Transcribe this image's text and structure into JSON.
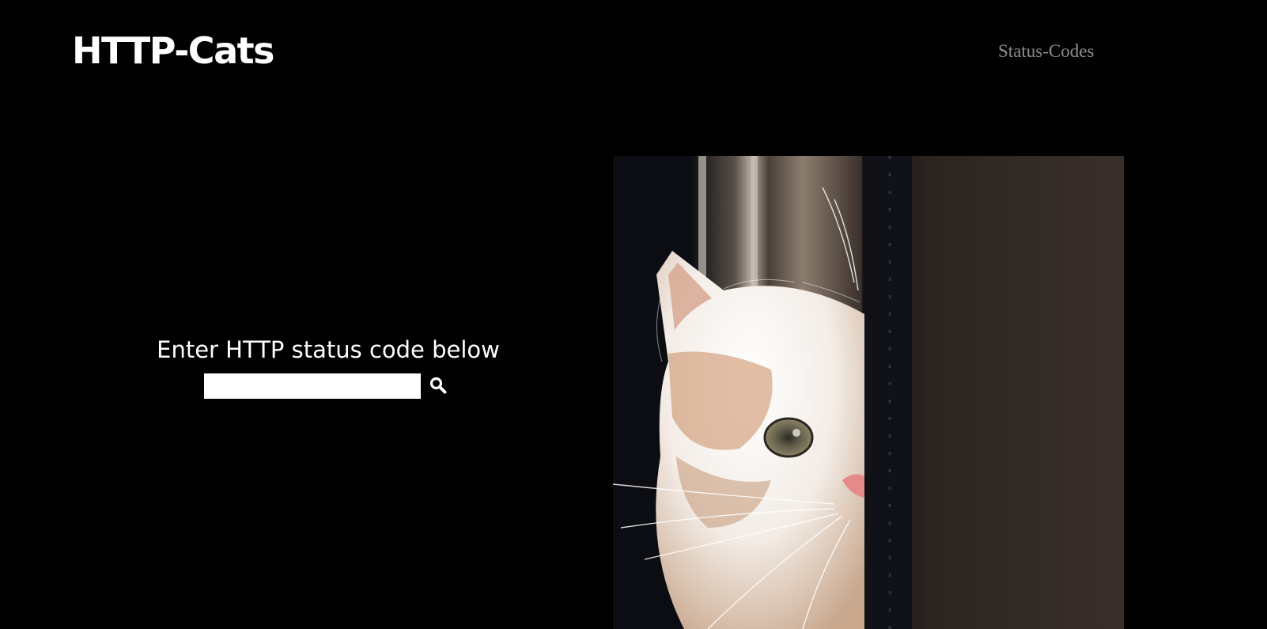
{
  "header": {
    "logo_text": "HTTP-Cats",
    "nav": {
      "status_codes_label": "Status-Codes"
    }
  },
  "search": {
    "prompt": "Enter HTTP status code below",
    "input_value": "",
    "input_placeholder": "",
    "button_icon": "search-icon"
  },
  "hero_image": {
    "subject": "kitten-peeking-from-curtain"
  },
  "colors": {
    "background": "#000000",
    "text": "#ffffff",
    "nav_text": "#8c8c8c",
    "input_background": "#ffffff"
  }
}
